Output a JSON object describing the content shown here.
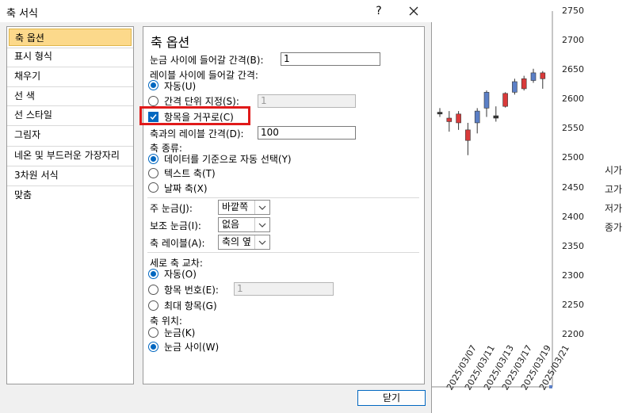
{
  "dialog": {
    "title": "축 서식",
    "help": "?",
    "close_icon": "close-icon",
    "ok_label": "닫기"
  },
  "nav": {
    "items": [
      "축 옵션",
      "표시 형식",
      "채우기",
      "선 색",
      "선 스타일",
      "그림자",
      "네온 및 부드러운 가장자리",
      "3차원 서식",
      "맞춤"
    ],
    "selected": 0
  },
  "panel": {
    "title": "축 옵션",
    "tick_interval_label": "눈금 사이에 들어갈 간격(B):",
    "tick_interval_value": "1",
    "label_interval_label": "레이블 사이에 들어갈 간격:",
    "auto_label": "자동(U)",
    "specify_label": "간격 단위 지정(S):",
    "specify_value": "1",
    "reverse_label": "항목을 거꾸로(C)",
    "label_distance_label": "축과의 레이블 간격(D):",
    "label_distance_value": "100",
    "axis_type_label": "축 종류:",
    "axis_type_auto": "데이터를 기준으로 자동 선택(Y)",
    "axis_type_text": "텍스트 축(T)",
    "axis_type_date": "날짜 축(X)",
    "major_tick_label": "주 눈금(J):",
    "major_tick_value": "바깥쪽",
    "minor_tick_label": "보조 눈금(I):",
    "minor_tick_value": "없음",
    "axis_labels_label": "축 레이블(A):",
    "axis_labels_value": "축의 옆",
    "vertical_cross_label": "세로 축 교차:",
    "cross_auto": "자동(O)",
    "cross_category": "항목 번호(E):",
    "cross_category_value": "1",
    "cross_max": "최대 항목(G)",
    "axis_position_label": "축 위치:",
    "pos_on_tick": "눈금(K)",
    "pos_between": "눈금 사이(W)"
  },
  "chart_data": {
    "type": "candlestick",
    "y_ticks": [
      "2750",
      "2700",
      "2650",
      "2600",
      "2550",
      "2500",
      "2450",
      "2400",
      "2350",
      "2300",
      "2250",
      "2200"
    ],
    "ylim": [
      2200,
      2750
    ],
    "x_ticks": [
      "2025/03/07",
      "2025/03/11",
      "2025/03/13",
      "2025/03/17",
      "2025/03/19",
      "2025/03/21"
    ],
    "legend": [
      "시가",
      "고가",
      "저가",
      "종가"
    ],
    "colors": {
      "up": "#5b7fc6",
      "down": "#d93a3a",
      "neutral": "#333333"
    },
    "candles": [
      {
        "open": 2575,
        "close": 2578,
        "high": 2585,
        "low": 2570
      },
      {
        "open": 2568,
        "close": 2562,
        "high": 2580,
        "low": 2545
      },
      {
        "open": 2575,
        "close": 2560,
        "high": 2580,
        "low": 2548
      },
      {
        "open": 2548,
        "close": 2530,
        "high": 2560,
        "low": 2505
      },
      {
        "open": 2560,
        "close": 2580,
        "high": 2585,
        "low": 2542
      },
      {
        "open": 2585,
        "close": 2612,
        "high": 2615,
        "low": 2570
      },
      {
        "open": 2568,
        "close": 2572,
        "high": 2588,
        "low": 2562
      },
      {
        "open": 2610,
        "close": 2588,
        "high": 2612,
        "low": 2586
      },
      {
        "open": 2612,
        "close": 2630,
        "high": 2635,
        "low": 2608
      },
      {
        "open": 2635,
        "close": 2618,
        "high": 2640,
        "low": 2615
      },
      {
        "open": 2632,
        "close": 2645,
        "high": 2652,
        "low": 2628
      },
      {
        "open": 2645,
        "close": 2635,
        "high": 2648,
        "low": 2618
      }
    ]
  }
}
